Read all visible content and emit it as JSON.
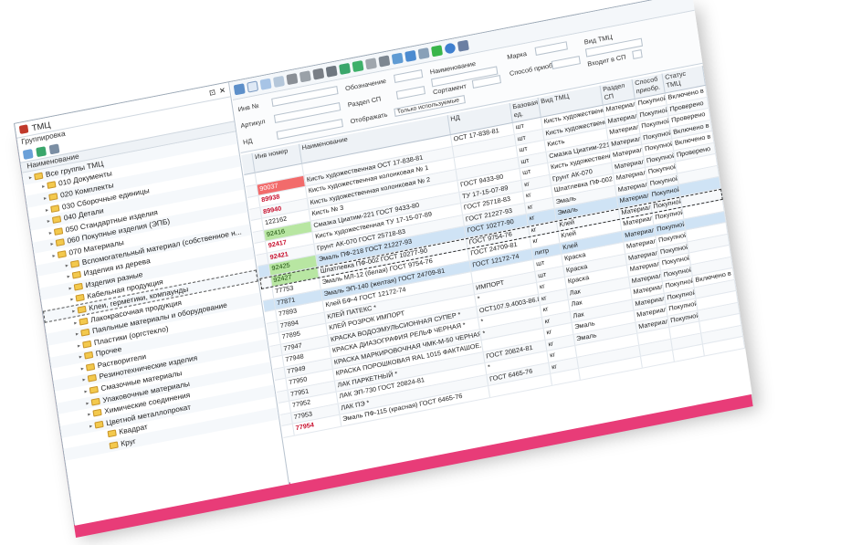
{
  "window": {
    "title": "ТМЦ",
    "controls": [
      "–",
      "□",
      "✕"
    ]
  },
  "left": {
    "title": "ТМЦ",
    "group_label": "Группировка",
    "column_header": "Наименование",
    "tree": [
      {
        "label": "Все группы ТМЦ",
        "level": 0
      },
      {
        "label": "010 Документы",
        "level": 1
      },
      {
        "label": "020 Комплекты",
        "level": 1
      },
      {
        "label": "030 Сборочные единицы",
        "level": 1
      },
      {
        "label": "040 Детали",
        "level": 1
      },
      {
        "label": "050 Стандартные изделия",
        "level": 1
      },
      {
        "label": "060 Покупные изделия (ЭПБ)",
        "level": 1
      },
      {
        "label": "070 Материалы",
        "level": 1
      },
      {
        "label": "Вспомогательный материал (собственное н...",
        "level": 2
      },
      {
        "label": "Изделия из дерева",
        "level": 2
      },
      {
        "label": "Изделия разные",
        "level": 2
      },
      {
        "label": "Кабельная продукция",
        "level": 2
      },
      {
        "label": "Клеи, герметики, компаунды",
        "level": 2
      },
      {
        "label": "Лакокрасочная продукция",
        "level": 2
      },
      {
        "label": "Паяльные материалы и оборудование",
        "level": 2
      },
      {
        "label": "Пластики (оргстекло)",
        "level": 2
      },
      {
        "label": "Прочее",
        "level": 2
      },
      {
        "label": "Растворители",
        "level": 2
      },
      {
        "label": "Резинотехнические изделия",
        "level": 2
      },
      {
        "label": "Смазочные материалы",
        "level": 2
      },
      {
        "label": "Упаковочные материалы",
        "level": 2
      },
      {
        "label": "Химические соединения",
        "level": 2
      },
      {
        "label": "Цветной металлопрокат",
        "level": 2
      },
      {
        "label": "Квадрат",
        "level": 3
      },
      {
        "label": "Круг",
        "level": 3
      }
    ]
  },
  "filters": {
    "labels": {
      "inv": "Инв №",
      "article": "Артикул",
      "nd": "НД",
      "designation": "Обозначение",
      "section": "Раздел СП",
      "show": "Отображать",
      "name": "Наименование",
      "assortment": "Сортамент",
      "brand": "Марка",
      "method": "Способ приоб",
      "type": "Вид ТМЦ",
      "in_sp": "Входит в СП"
    },
    "show_value": "Только используемые"
  },
  "grid": {
    "headers": [
      "",
      "Инв номер",
      "Наименование",
      "НД",
      "Базовая ед. изм.",
      "Вид ТМЦ",
      "Раздел СП",
      "Способ приобр.",
      "Статус ТМЦ"
    ],
    "rows": [
      {
        "num": "",
        "name": "",
        "nd": "ОСТ 17-838-81",
        "unit": "шт",
        "kind": "Кисть художественна...",
        "sect": "Материалы",
        "way": "Покупной",
        "status": "Включено в ..."
      },
      {
        "num": "90037",
        "style": "red",
        "name": "Кисть художественная ОСТ 17-838-81",
        "nd": "",
        "unit": "шт",
        "kind": "Кисть художественна...",
        "sect": "Материалы",
        "way": "Покупной",
        "status": "Проверено"
      },
      {
        "num": "89938",
        "style": "boldred",
        "name": "Кисть художественная колонковая № 1",
        "nd": "",
        "unit": "шт",
        "kind": "Кисть",
        "sect": "Материалы",
        "way": "Покупной",
        "status": "Проверено"
      },
      {
        "num": "89940",
        "style": "boldred",
        "name": "Кисть художественная колонковая № 2",
        "nd": "",
        "unit": "шт",
        "kind": "Смазка Циатим-221",
        "sect": "Материалы",
        "way": "Покупной",
        "status": "Включено в ..."
      },
      {
        "num": "122162",
        "name": "Кисть № 3",
        "nd": "ГОСТ 9433-80",
        "unit": "шт",
        "kind": "Кисть художественна...",
        "sect": "Материалы",
        "way": "Покупной",
        "status": "Включено в ..."
      },
      {
        "num": "92416",
        "style": "green",
        "name": "Смазка Циатим-221  ГОСТ 9433-80",
        "nd": "ТУ 17-15-07-89",
        "unit": "кг",
        "kind": "Грунт АК-070",
        "sect": "Материалы",
        "way": "Покупной",
        "status": "Проверено"
      },
      {
        "num": "92417",
        "style": "boldred",
        "name": "Кисть художественная  ТУ 17-15-07-89",
        "nd": "ГОСТ 25718-83",
        "unit": "кг",
        "kind": "Шпатлевка ПФ-002",
        "sect": "Материалы",
        "way": "Покупной",
        "status": ""
      },
      {
        "num": "92421",
        "style": "boldred",
        "name": "Грунт АК-070  ГОСТ 25718-83",
        "nd": "ГОСТ 21227-93",
        "unit": "кг",
        "kind": "Эмаль",
        "sect": "Материалы",
        "way": "Покупной",
        "status": ""
      },
      {
        "num": "92425",
        "style": "green",
        "name": "Эмаль ПФ-218  ГОСТ 21227-93",
        "nd": "ГОСТ 10277-90",
        "unit": "кг",
        "kind": "Эмаль",
        "sect": "Материалы",
        "way": "Покупной",
        "status": "",
        "hl": true
      },
      {
        "num": "92427",
        "style": "green",
        "name": "Шпатлевка ПФ-002  ГОСТ 10277-90",
        "nd": "ГОСТ 9754-76",
        "unit": "кг",
        "kind": "Клей",
        "sect": "Материалы",
        "way": "Покупной",
        "status": "",
        "sel": true
      },
      {
        "num": "77753",
        "name": "Эмаль МЛ-12 (белая) ГОСТ 9754-76",
        "nd": "ГОСТ 24709-81",
        "unit": "кг",
        "kind": "Клей",
        "sect": "Материалы",
        "way": "Покупной",
        "status": ""
      },
      {
        "num": "77871",
        "name": "Эмаль ЭП-140 (желтая) ГОСТ 24709-81",
        "nd": "ГОСТ 12172-74",
        "unit": "литр",
        "kind": "Клей",
        "sect": "Материалы",
        "way": "Покупной",
        "status": "",
        "hl": true
      },
      {
        "num": "77893",
        "name": "Клей БФ-4 ГОСТ 12172-74",
        "nd": "",
        "unit": "шт",
        "kind": "Краска",
        "sect": "Материалы",
        "way": "Покупной",
        "status": ""
      },
      {
        "num": "77894",
        "name": "КЛЕЙ ПАТЕКС *",
        "nd": "ИМПОРТ",
        "unit": "шт",
        "kind": "Краска",
        "sect": "Материалы",
        "way": "Покупной",
        "status": ""
      },
      {
        "num": "77895",
        "name": "КЛЕЙ РОЗРОК ИМПОРТ",
        "nd": "*",
        "unit": "кг",
        "kind": "Краска",
        "sect": "Материалы",
        "way": "Покупной",
        "status": ""
      },
      {
        "num": "77947",
        "name": "КРАСКА ВОДОЭМУЛЬСИОННАЯ  СУПЕР *",
        "nd": "ОСТ107.9.4003-86.82",
        "unit": "кг",
        "kind": "Лак",
        "sect": "Материалы",
        "way": "Покупной",
        "status": ""
      },
      {
        "num": "77948",
        "name": "КРАСКА ДИАЗОГРАФИЯ РЕЛЬФ ЧЕРНАЯ *",
        "nd": "*",
        "unit": "кг",
        "kind": "Лак",
        "sect": "Материалы",
        "way": "Покупной",
        "status": "Включено в ..."
      },
      {
        "num": "77949",
        "name": "КРАСКА МАРКИРОВОЧНАЯ ЧМК-М-50 ЧЕРНАЯ ...",
        "nd": "*",
        "unit": "кг",
        "kind": "Лак",
        "sect": "Материалы",
        "way": "Покупной",
        "status": ""
      },
      {
        "num": "77950",
        "name": "КРАСКА ПОРОШКОВАЯ RAL 1015 ФАКТАШОЕ...",
        "nd": "",
        "unit": "кг",
        "kind": "Эмаль",
        "sect": "Материалы",
        "way": "Покупной",
        "status": ""
      },
      {
        "num": "77951",
        "name": "ЛАК ПАРКЕТНЫЙ *",
        "nd": "ГОСТ 20824-81",
        "unit": "кг",
        "kind": "Эмаль",
        "sect": "Материалы",
        "way": "Покупной",
        "status": ""
      },
      {
        "num": "77952",
        "name": "ЛАК ЭП-730  ГОСТ 20824-81",
        "nd": "*",
        "unit": "кг",
        "kind": "",
        "sect": "",
        "way": "",
        "status": ""
      },
      {
        "num": "77953",
        "name": "ЛАК ПЭ *",
        "nd": "ГОСТ 6465-76",
        "unit": "кг",
        "kind": "",
        "sect": "",
        "way": "",
        "status": ""
      },
      {
        "num": "77954",
        "style": "boldred",
        "name": "Эмаль ПФ-115 (красная) ГОСТ 6465-76",
        "nd": "",
        "unit": "",
        "kind": "",
        "sect": "",
        "way": "",
        "status": ""
      }
    ]
  },
  "colors": {
    "accent": "#e83c78",
    "red_cell": "#f26b6b",
    "green_cell": "#b8e6a2",
    "highlight_row": "#cfe3f5"
  }
}
